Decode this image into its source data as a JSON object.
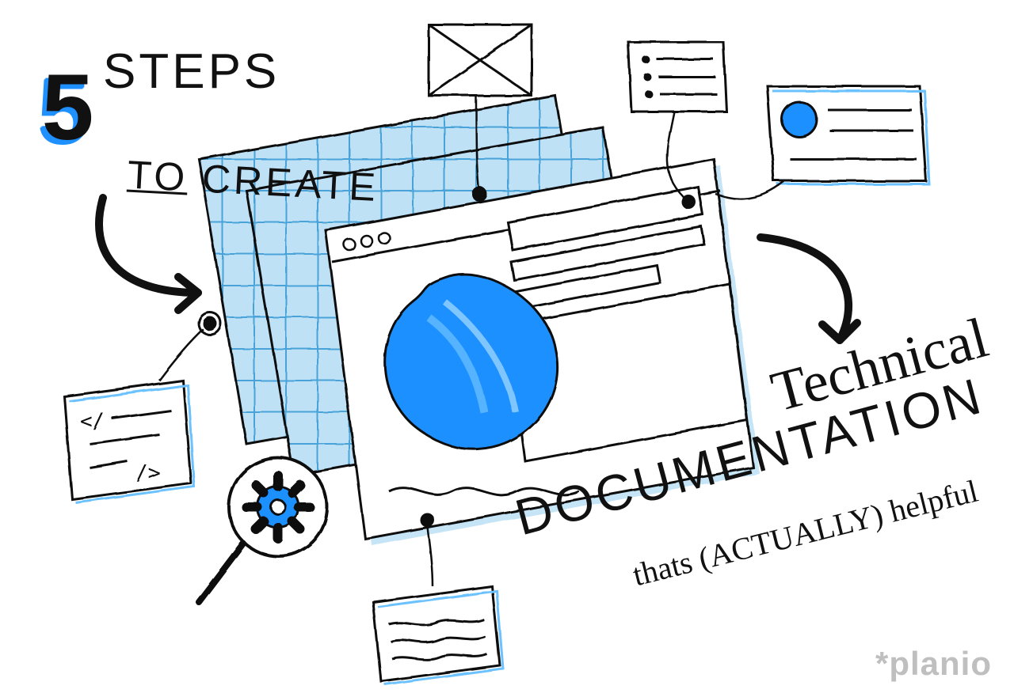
{
  "title": {
    "number": "5",
    "word1": "STEPS",
    "word2_prefix": "TO",
    "word2_rest": " CREATE"
  },
  "subtitle": {
    "line1": "Technical",
    "line2": "DOCUMENTATION",
    "line3": "thats (ACTUALLY) helpful"
  },
  "brand": {
    "name": "planio",
    "symbol": "*"
  },
  "colors": {
    "accent": "#1e90ff",
    "ink": "#111111",
    "grid": "#6cb6e5",
    "panel": "#bfe1f6",
    "logo": "#bfbfbf"
  },
  "callouts": {
    "image_placeholder": "image-placeholder",
    "bullet_list": "bullet-list",
    "profile_card": "profile-card",
    "code_block": "code-block",
    "text_block": "text-block"
  }
}
